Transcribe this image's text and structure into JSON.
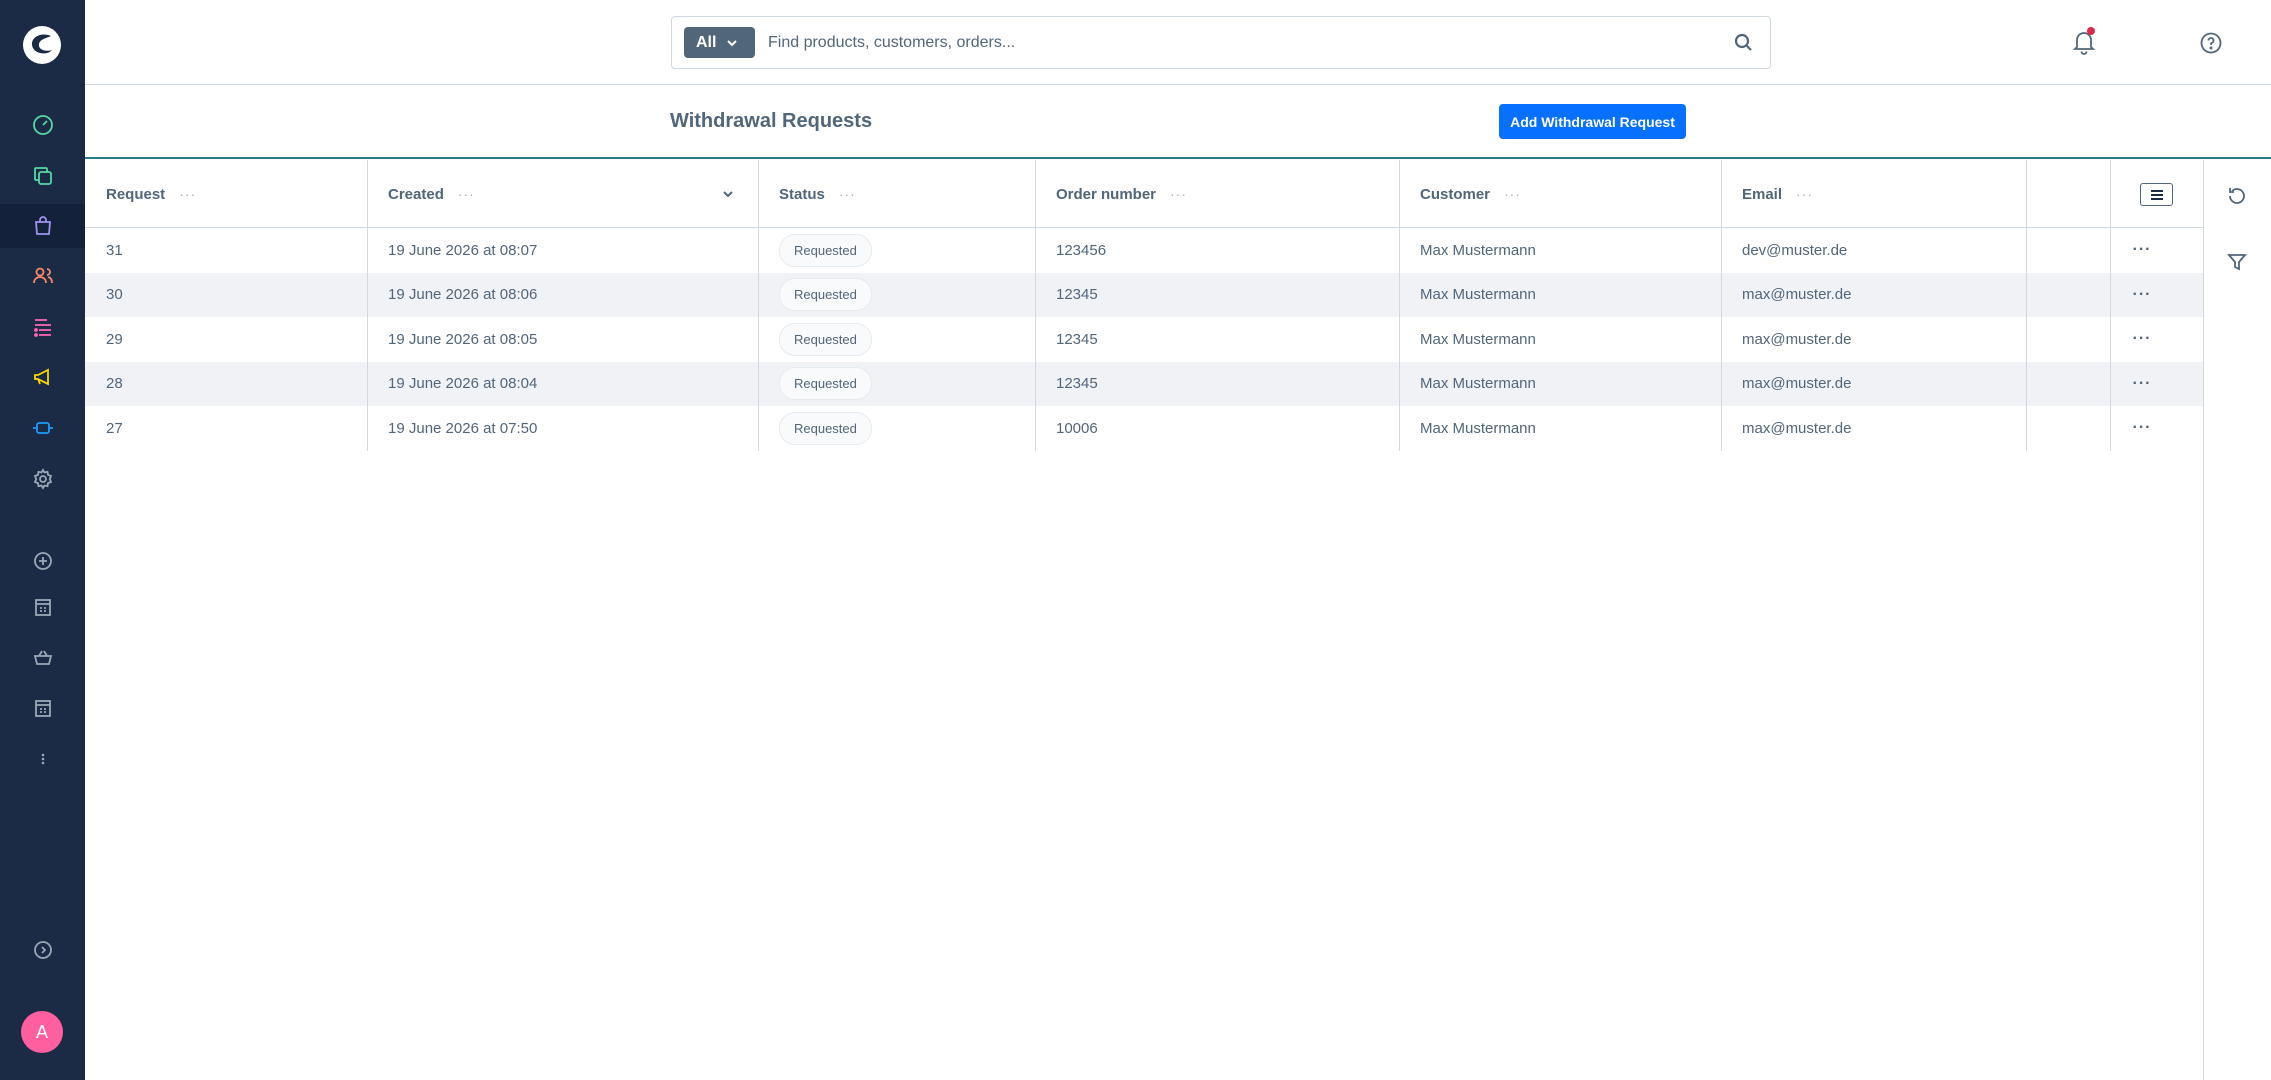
{
  "app": {
    "avatar_initial": "A",
    "accent": "#189eff",
    "brand": "#0870ff",
    "sidebar_bg": "#1b2a45"
  },
  "sidebar": {
    "items": [
      {
        "name": "dashboard",
        "icon": "gauge-icon",
        "color": "#57d9a3"
      },
      {
        "name": "catalogues",
        "icon": "copy-icon",
        "color": "#57d9a3"
      },
      {
        "name": "orders",
        "icon": "shopping-bag-icon",
        "color": "#a092f0"
      },
      {
        "name": "customers",
        "icon": "users-icon",
        "color": "#f88962"
      },
      {
        "name": "content",
        "icon": "content-icon",
        "color": "#ff68b4"
      },
      {
        "name": "marketing",
        "icon": "megaphone-icon",
        "color": "#ffd700"
      },
      {
        "name": "extensions",
        "icon": "plug-icon",
        "color": "#189eff"
      },
      {
        "name": "settings",
        "icon": "gear-icon",
        "color": "#9aa8b5"
      },
      {
        "name": "add-channel",
        "icon": "plus-circle-icon",
        "color": "#9aa8b5"
      },
      {
        "name": "storefront-1",
        "icon": "storefront-icon",
        "color": "#9aa8b5"
      },
      {
        "name": "headless",
        "icon": "basket-icon",
        "color": "#9aa8b5"
      },
      {
        "name": "storefront-2",
        "icon": "storefront-icon",
        "color": "#9aa8b5"
      },
      {
        "name": "more",
        "icon": "more-vertical-icon",
        "color": "#9aa8b5"
      },
      {
        "name": "collapse",
        "icon": "chevron-circle-icon",
        "color": "#9aa8b5"
      }
    ]
  },
  "search": {
    "type_label": "All",
    "placeholder": "Find products, customers, orders..."
  },
  "page": {
    "title": "Withdrawal Requests",
    "add_button_label": "Add Withdrawal Request"
  },
  "grid": {
    "columns": [
      "Request",
      "Created",
      "Status",
      "Order number",
      "Customer",
      "Email"
    ],
    "rows": [
      {
        "request": "31",
        "created": "19 June 2026 at 08:07",
        "status": "Requested",
        "order": "123456",
        "customer": "Max Mustermann",
        "email": "dev@muster.de"
      },
      {
        "request": "30",
        "created": "19 June 2026 at 08:06",
        "status": "Requested",
        "order": "12345",
        "customer": "Max Mustermann",
        "email": "max@muster.de"
      },
      {
        "request": "29",
        "created": "19 June 2026 at 08:05",
        "status": "Requested",
        "order": "12345",
        "customer": "Max Mustermann",
        "email": "max@muster.de"
      },
      {
        "request": "28",
        "created": "19 June 2026 at 08:04",
        "status": "Requested",
        "order": "12345",
        "customer": "Max Mustermann",
        "email": "max@muster.de"
      },
      {
        "request": "27",
        "created": "19 June 2026 at 07:50",
        "status": "Requested",
        "order": "10006",
        "customer": "Max Mustermann",
        "email": "max@muster.de"
      }
    ]
  }
}
